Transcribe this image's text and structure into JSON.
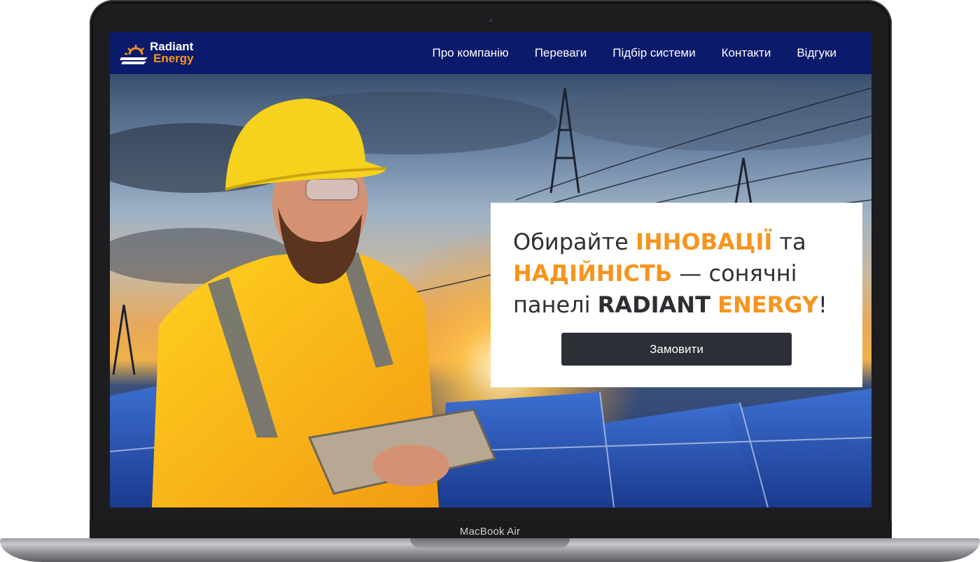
{
  "device": {
    "model_label": "MacBook Air"
  },
  "brand": {
    "name_line1": "Radiant",
    "name_line2": "Energy",
    "accent_color": "#f7941d",
    "nav_color": "#0b1a6b"
  },
  "nav": {
    "items": [
      {
        "label": "Про компанію"
      },
      {
        "label": "Переваги"
      },
      {
        "label": "Підбір системи"
      },
      {
        "label": "Контакти"
      },
      {
        "label": "Відгуки"
      }
    ]
  },
  "hero": {
    "headline_part1": "Обирайте ",
    "headline_accent1": "ІННОВАЦІЇ",
    "headline_part2": " та ",
    "headline_accent2": "НАДІЙНІСТЬ",
    "headline_part3": " — сонячні панелі ",
    "headline_strong": "RADIANT",
    "headline_space": " ",
    "headline_accent3": "ENERGY",
    "headline_end": "!",
    "cta_label": "Замовити",
    "image_subject": "engineer in hard hat with tablet in front of solar panels and power lines"
  }
}
